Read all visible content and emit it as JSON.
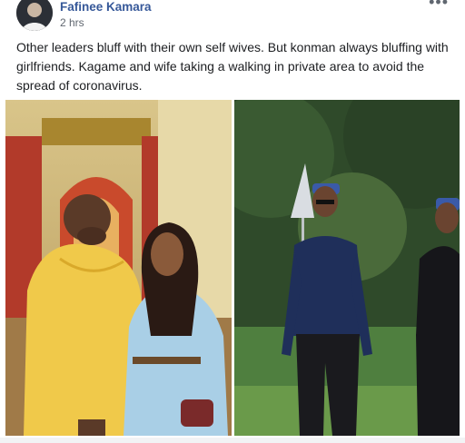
{
  "post": {
    "author_name": "Fafinee Kamara",
    "timestamp": "2 hrs",
    "more_options_icon": "more-horizontal-icon",
    "text": "Other leaders bluff with their own self wives. But konman always bluffing with girlfriends. Kagame and wife taking a walking in private area to avoid the spread of coronavirus.",
    "link_color": "#365899"
  },
  "photos": {
    "left": {
      "subject": "man in yellow kaftan and woman in light blue dress in ornate room",
      "colors": [
        "#f0d070",
        "#a9cfe6",
        "#c94a2c"
      ]
    },
    "right": {
      "subject": "man in navy sweater and cap walking with woman in black outdoors",
      "colors": [
        "#2f4a2a",
        "#1f2f5a",
        "#4f7f3f"
      ]
    }
  }
}
